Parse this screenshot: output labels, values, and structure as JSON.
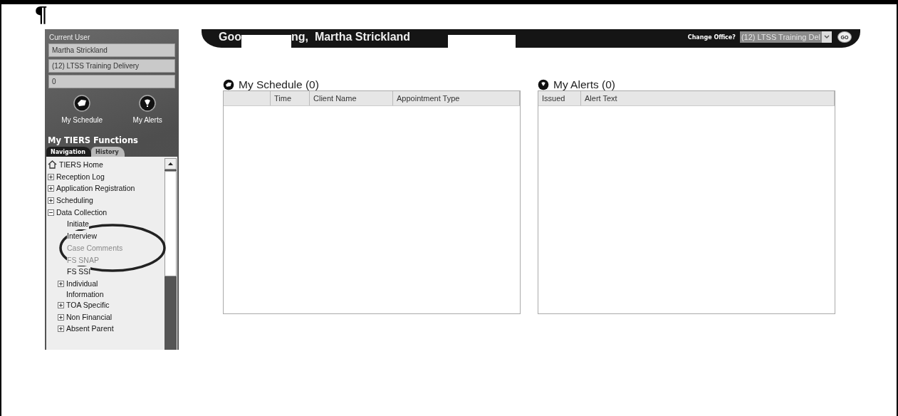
{
  "document": {
    "mark": "¶"
  },
  "sidebar": {
    "current_user_label": "Current User",
    "fields": [
      "Martha Strickland",
      "(12) LTSS Training Delivery",
      "0"
    ],
    "shortcuts": [
      {
        "kind": "schedule",
        "label": "My Schedule"
      },
      {
        "kind": "alerts",
        "label": "My Alerts"
      }
    ],
    "functions_title": "My TIERS Functions",
    "tabs": [
      {
        "label": "Navigation",
        "selected": true
      },
      {
        "label": "History",
        "selected": false
      }
    ],
    "tree": [
      {
        "kind": "home",
        "label": "TIERS Home"
      },
      {
        "kind": "folder",
        "label": "Reception Log",
        "expanded": false
      },
      {
        "kind": "folder",
        "label": "Application Registration",
        "expanded": false
      },
      {
        "kind": "folder",
        "label": "Scheduling",
        "expanded": false
      },
      {
        "kind": "folder",
        "label": "Data Collection",
        "expanded": true,
        "children": [
          {
            "kind": "page",
            "label": "Initiate",
            "disabled": false
          },
          {
            "kind": "page",
            "label": "Interview",
            "disabled": false
          },
          {
            "kind": "page",
            "label": "Case Comments",
            "disabled": true
          },
          {
            "kind": "page",
            "label": "FS SNAP",
            "disabled": true
          },
          {
            "kind": "page",
            "label": "FS SSI",
            "disabled": false
          },
          {
            "kind": "folder",
            "label": "Individual Information",
            "expanded": false
          },
          {
            "kind": "folder",
            "label": "TOA Specific",
            "expanded": false
          },
          {
            "kind": "folder",
            "label": "Non Financial",
            "expanded": false
          },
          {
            "kind": "folder",
            "label": "Absent Parent",
            "expanded": false
          }
        ]
      }
    ]
  },
  "header": {
    "greeting_start": "Goo",
    "greeting_end": "ng,  Martha Strickland",
    "change_office_label": "Change Office?",
    "office_select": "(12) LTSS Training Del",
    "go_button": "GO"
  },
  "panels": [
    {
      "kind": "schedule",
      "title": "My Schedule (0)",
      "columns": [
        "",
        "Time",
        "Client Name",
        "Appointment Type"
      ]
    },
    {
      "kind": "alerts",
      "title": "My Alerts (0)",
      "columns": [
        "Issued",
        "Alert Text"
      ]
    }
  ]
}
